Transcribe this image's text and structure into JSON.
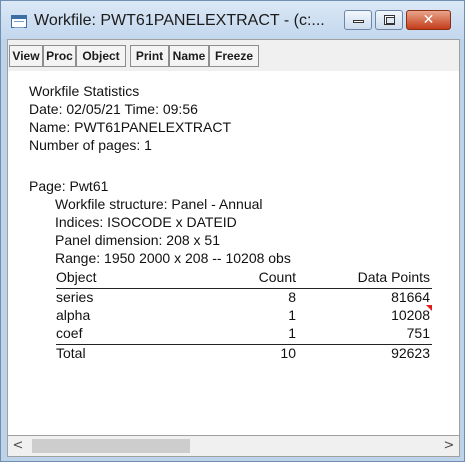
{
  "window": {
    "title": "Workfile: PWT61PANELEXTRACT - (c:...",
    "buttons": {
      "minimize": "minimize-icon",
      "maximize": "maximize-icon",
      "close": "close-icon"
    }
  },
  "toolbar": {
    "view": "View",
    "proc": "Proc",
    "object": "Object",
    "print": "Print",
    "name": "Name",
    "freeze": "Freeze"
  },
  "stats": {
    "heading": "Workfile Statistics",
    "date_line": "Date: 02/05/21   Time: 09:56",
    "name_line": "Name: PWT61PANELEXTRACT",
    "pages_line": "Number of pages: 1"
  },
  "page": {
    "label": "Page: Pwt61",
    "structure": "Workfile structure: Panel - Annual",
    "indices": "Indices: ISOCODE x DATEID",
    "dimension": "Panel dimension: 208 x 51",
    "range": "Range: 1950 2000 x 208  --  10208 obs"
  },
  "table": {
    "headers": [
      "Object",
      "Count",
      "Data Points"
    ],
    "rows": [
      {
        "object": "series",
        "count": "8",
        "points": "81664"
      },
      {
        "object": "alpha",
        "count": "1",
        "points": "10208"
      },
      {
        "object": "coef",
        "count": "1",
        "points": "751"
      }
    ],
    "total": {
      "object": "Total",
      "count": "10",
      "points": "92623"
    }
  },
  "scrollbar": {
    "left": "<",
    "right": ">"
  },
  "colors": {
    "titlebar": "#c3d7ee",
    "close_button": "#c43b18",
    "marker": "#e21b1b"
  }
}
